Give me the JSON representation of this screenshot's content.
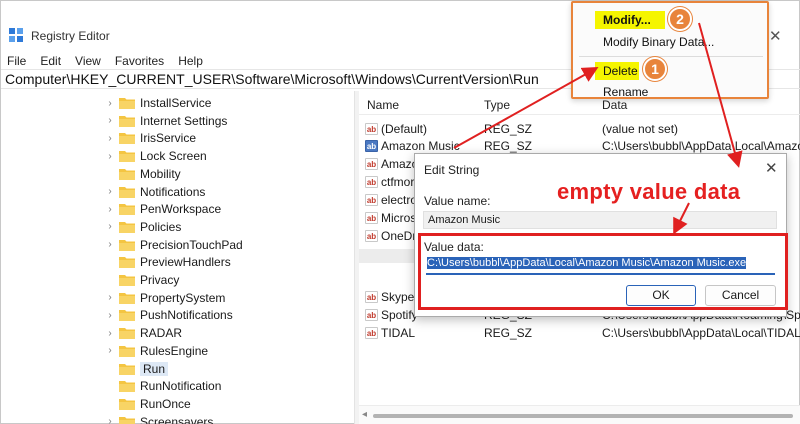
{
  "window": {
    "title": "Registry Editor",
    "close_glyph": "✕"
  },
  "menu": [
    "File",
    "Edit",
    "View",
    "Favorites",
    "Help"
  ],
  "address_path": "Computer\\HKEY_CURRENT_USER\\Software\\Microsoft\\Windows\\CurrentVersion\\Run",
  "tree": {
    "items": [
      {
        "label": "InstallService",
        "chevron": "›"
      },
      {
        "label": "Internet Settings",
        "chevron": "›"
      },
      {
        "label": "IrisService",
        "chevron": "›"
      },
      {
        "label": "Lock Screen",
        "chevron": "›"
      },
      {
        "label": "Mobility",
        "chevron": ""
      },
      {
        "label": "Notifications",
        "chevron": "›"
      },
      {
        "label": "PenWorkspace",
        "chevron": "›"
      },
      {
        "label": "Policies",
        "chevron": "›"
      },
      {
        "label": "PrecisionTouchPad",
        "chevron": "›"
      },
      {
        "label": "PreviewHandlers",
        "chevron": ""
      },
      {
        "label": "Privacy",
        "chevron": ""
      },
      {
        "label": "PropertySystem",
        "chevron": "›"
      },
      {
        "label": "PushNotifications",
        "chevron": "›"
      },
      {
        "label": "RADAR",
        "chevron": "›"
      },
      {
        "label": "RulesEngine",
        "chevron": "›"
      },
      {
        "label": "Run",
        "chevron": "",
        "selected": true
      },
      {
        "label": "RunNotification",
        "chevron": ""
      },
      {
        "label": "RunOnce",
        "chevron": ""
      },
      {
        "label": "Screensavers",
        "chevron": "›"
      }
    ]
  },
  "list": {
    "columns": {
      "name": "Name",
      "type": "Type",
      "data": "Data"
    },
    "rows": [
      {
        "name": "(Default)",
        "type": "REG_SZ",
        "data": "(value not set)"
      },
      {
        "name": "Amazon Music",
        "type": "REG_SZ",
        "data": "C:\\Users\\bubbl\\AppData\\Local\\Amazo",
        "selected": true
      },
      {
        "name": "Amazo",
        "type": "",
        "data": "c"
      },
      {
        "name": "ctfmor",
        "type": "",
        "data": ""
      },
      {
        "name": "electro",
        "type": "",
        "data": "c"
      },
      {
        "name": "Micros",
        "type": "",
        "data": "dg"
      },
      {
        "name": "OneDr",
        "type": "",
        "data": "rv"
      },
      {
        "name": "",
        "type": "",
        "data": "u"
      },
      {
        "name": "Skype",
        "type": "",
        "data": "yp"
      },
      {
        "name": "Spotify",
        "type": "REG_SZ",
        "data": "C:\\Users\\bubbl\\AppData\\Roaming\\Sp"
      },
      {
        "name": "TIDAL",
        "type": "REG_SZ",
        "data": "C:\\Users\\bubbl\\AppData\\Local\\TIDAL\\"
      }
    ],
    "icon_text": "ab"
  },
  "context_menu": {
    "items": {
      "modify": "Modify...",
      "modify_binary": "Modify Binary Data...",
      "delete": "Delete",
      "rename": "Rename"
    },
    "highlight_color": "#f5f500"
  },
  "badges": {
    "one": "1",
    "two": "2"
  },
  "dialog": {
    "title": "Edit String",
    "close_glyph": "✕",
    "value_name_label": "Value name:",
    "value_name": "Amazon Music",
    "value_data_label": "Value data:",
    "value_data": "C:\\Users\\bubbl\\AppData\\Local\\Amazon Music\\Amazon Music.exe",
    "ok": "OK",
    "cancel": "Cancel"
  },
  "annotation": {
    "text": "empty value data",
    "color": "#e52020"
  },
  "colors": {
    "accent": "#e8843b",
    "annotation_red": "#e02020",
    "selection_blue": "#2a63b8",
    "folder_yellow": "#f4c542"
  }
}
